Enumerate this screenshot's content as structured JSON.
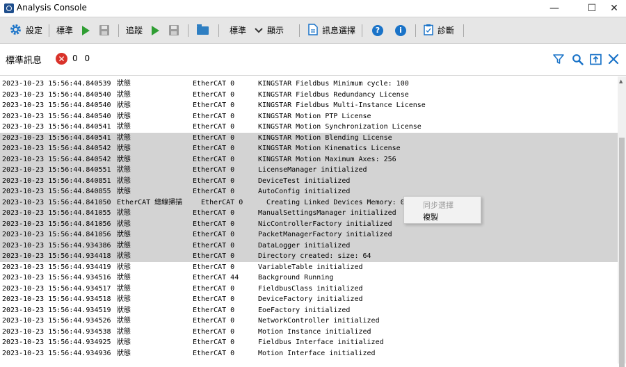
{
  "window": {
    "title": "Analysis Console",
    "minimize": "—",
    "maximize": "☐",
    "close": "✕"
  },
  "toolbar": {
    "settings_label": "設定",
    "standard_label": "標準",
    "trace_label": "追蹤",
    "standard2_label": "標準",
    "display_label": "顯示",
    "message_select_label": "訊息選擇",
    "diagnose_label": "診斷",
    "help_icon_text": "?",
    "info_icon_text": "i"
  },
  "header": {
    "title": "標準訊息",
    "error_icon_text": "✕",
    "counts": "0 0"
  },
  "context_menu": {
    "items": [
      "同步選擇",
      "複製"
    ]
  },
  "log": {
    "rows": [
      {
        "time": "2023-10-23 15:56:44.840539",
        "type": "狀態",
        "source": "EtherCAT 0",
        "message": "KINGSTAR Fieldbus Minimum cycle: 100",
        "selected": false
      },
      {
        "time": "2023-10-23 15:56:44.840540",
        "type": "狀態",
        "source": "EtherCAT 0",
        "message": "KINGSTAR Fieldbus Redundancy License",
        "selected": false
      },
      {
        "time": "2023-10-23 15:56:44.840540",
        "type": "狀態",
        "source": "EtherCAT 0",
        "message": "KINGSTAR Fieldbus Multi-Instance License",
        "selected": false
      },
      {
        "time": "2023-10-23 15:56:44.840540",
        "type": "狀態",
        "source": "EtherCAT 0",
        "message": "KINGSTAR Motion PTP License",
        "selected": false
      },
      {
        "time": "2023-10-23 15:56:44.840541",
        "type": "狀態",
        "source": "EtherCAT 0",
        "message": "KINGSTAR Motion Synchronization License",
        "selected": false
      },
      {
        "time": "2023-10-23 15:56:44.840541",
        "type": "狀態",
        "source": "EtherCAT 0",
        "message": "KINGSTAR Motion Blending License",
        "selected": true
      },
      {
        "time": "2023-10-23 15:56:44.840542",
        "type": "狀態",
        "source": "EtherCAT 0",
        "message": "KINGSTAR Motion Kinematics License",
        "selected": true
      },
      {
        "time": "2023-10-23 15:56:44.840542",
        "type": "狀態",
        "source": "EtherCAT 0",
        "message": "KINGSTAR Motion Maximum Axes: 256",
        "selected": true
      },
      {
        "time": "2023-10-23 15:56:44.840551",
        "type": "狀態",
        "source": "EtherCAT 0",
        "message": "LicenseManager initialized",
        "selected": true
      },
      {
        "time": "2023-10-23 15:56:44.840851",
        "type": "狀態",
        "source": "EtherCAT 0",
        "message": "DeviceTest initialized",
        "selected": true
      },
      {
        "time": "2023-10-23 15:56:44.840855",
        "type": "狀態",
        "source": "EtherCAT 0",
        "message": "AutoConfig initialized",
        "selected": true
      },
      {
        "time": "2023-10-23 15:56:44.841050",
        "type": "EtherCAT 總線掃描",
        "source": "  EtherCAT 0",
        "message": "  Creating Linked Devices Memory: 0",
        "selected": true
      },
      {
        "time": "2023-10-23 15:56:44.841055",
        "type": "狀態",
        "source": "EtherCAT 0",
        "message": "ManualSettingsManager initialized",
        "selected": true
      },
      {
        "time": "2023-10-23 15:56:44.841056",
        "type": "狀態",
        "source": "EtherCAT 0",
        "message": "NicControllerFactory initialized",
        "selected": true
      },
      {
        "time": "2023-10-23 15:56:44.841056",
        "type": "狀態",
        "source": "EtherCAT 0",
        "message": "PacketManagerFactory initialized",
        "selected": true
      },
      {
        "time": "2023-10-23 15:56:44.934386",
        "type": "狀態",
        "source": "EtherCAT 0",
        "message": "DataLogger initialized",
        "selected": true
      },
      {
        "time": "2023-10-23 15:56:44.934418",
        "type": "狀態",
        "source": "EtherCAT 0",
        "message": "Directory created: size: 64",
        "selected": true
      },
      {
        "time": "2023-10-23 15:56:44.934419",
        "type": "狀態",
        "source": "EtherCAT 0",
        "message": "VariableTable initialized",
        "selected": false
      },
      {
        "time": "2023-10-23 15:56:44.934516",
        "type": "狀態",
        "source": "EtherCAT 44",
        "message": "Background Running",
        "selected": false
      },
      {
        "time": "2023-10-23 15:56:44.934517",
        "type": "狀態",
        "source": "EtherCAT 0",
        "message": "FieldbusClass initialized",
        "selected": false
      },
      {
        "time": "2023-10-23 15:56:44.934518",
        "type": "狀態",
        "source": "EtherCAT 0",
        "message": "DeviceFactory initialized",
        "selected": false
      },
      {
        "time": "2023-10-23 15:56:44.934519",
        "type": "狀態",
        "source": "EtherCAT 0",
        "message": "EoeFactory initialized",
        "selected": false
      },
      {
        "time": "2023-10-23 15:56:44.934526",
        "type": "狀態",
        "source": "EtherCAT 0",
        "message": "NetworkController initialized",
        "selected": false
      },
      {
        "time": "2023-10-23 15:56:44.934538",
        "type": "狀態",
        "source": "EtherCAT 0",
        "message": "Motion Instance initialized",
        "selected": false
      },
      {
        "time": "2023-10-23 15:56:44.934925",
        "type": "狀態",
        "source": "EtherCAT 0",
        "message": "Fieldbus Interface initialized",
        "selected": false
      },
      {
        "time": "2023-10-23 15:56:44.934936",
        "type": "狀態",
        "source": "EtherCAT 0",
        "message": "Motion Interface initialized",
        "selected": false
      }
    ]
  },
  "colors": {
    "accent": "#1a73c8",
    "selection": "#d3d3d3",
    "error": "#d9322a",
    "play": "#2f9e33"
  }
}
